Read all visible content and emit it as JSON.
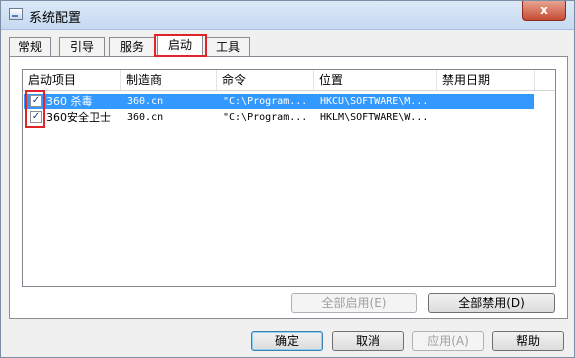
{
  "window": {
    "title": "系统配置",
    "close_glyph": "x"
  },
  "tabs": [
    {
      "label": "常规"
    },
    {
      "label": "引导"
    },
    {
      "label": "服务"
    },
    {
      "label": "启动"
    },
    {
      "label": "工具"
    }
  ],
  "active_tab": "启动",
  "list": {
    "columns": [
      "启动项目",
      "制造商",
      "命令",
      "位置",
      "禁用日期"
    ],
    "rows": [
      {
        "checked": true,
        "selected": true,
        "item": "360 杀毒",
        "manufacturer": "360.cn",
        "command": "\"C:\\Program...",
        "location": "HKCU\\SOFTWARE\\M...",
        "disabled_date": ""
      },
      {
        "checked": true,
        "selected": false,
        "item": "360安全卫士",
        "manufacturer": "360.cn",
        "command": "\"C:\\Program...",
        "location": "HKLM\\SOFTWARE\\W...",
        "disabled_date": ""
      }
    ]
  },
  "buttons": {
    "enable_all": "全部启用(E)",
    "disable_all": "全部禁用(D)",
    "ok": "确定",
    "cancel": "取消",
    "apply": "应用(A)",
    "help": "帮助"
  },
  "colors": {
    "selection": "#3399ff",
    "highlight_box": "#e0252a"
  },
  "check_glyph": "✓"
}
